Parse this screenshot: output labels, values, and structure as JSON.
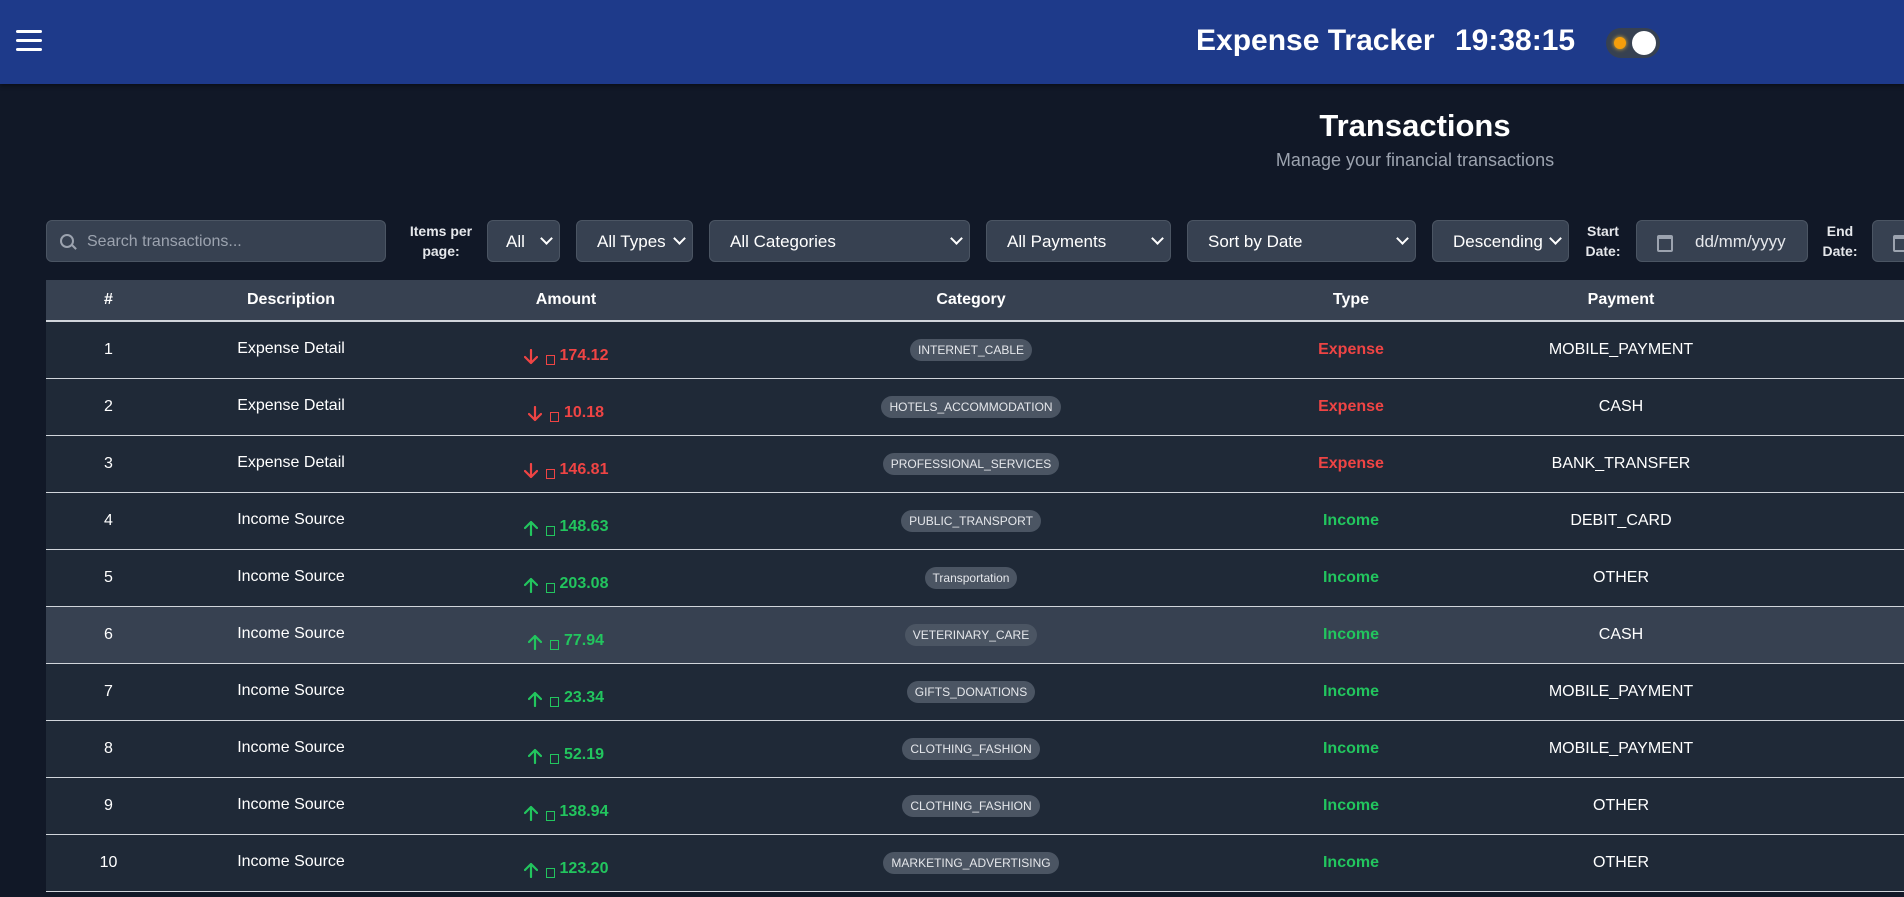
{
  "header": {
    "title": "Expense Tracker",
    "clock": "19:38:15"
  },
  "page": {
    "title": "Transactions",
    "subtitle": "Manage your financial transactions"
  },
  "filters": {
    "search_placeholder": "Search transactions...",
    "items_per_page_label": "Items per page:",
    "items_per_page_value": "All",
    "type_value": "All Types",
    "category_value": "All Categories",
    "payment_value": "All Payments",
    "sort_by_value": "Sort by Date",
    "order_value": "Descending",
    "start_date_label": "Start Date:",
    "start_date_placeholder": "dd/mm/yyyy",
    "end_date_label": "End Date:"
  },
  "table": {
    "columns": [
      "#",
      "Description",
      "Amount",
      "Category",
      "Type",
      "Payment"
    ],
    "rows": [
      {
        "num": "1",
        "description": "Expense Detail",
        "amount": "174.12",
        "category": "INTERNET_CABLE",
        "type": "Expense",
        "payment": "MOBILE_PAYMENT"
      },
      {
        "num": "2",
        "description": "Expense Detail",
        "amount": "10.18",
        "category": "HOTELS_ACCOMMODATION",
        "type": "Expense",
        "payment": "CASH"
      },
      {
        "num": "3",
        "description": "Expense Detail",
        "amount": "146.81",
        "category": "PROFESSIONAL_SERVICES",
        "type": "Expense",
        "payment": "BANK_TRANSFER"
      },
      {
        "num": "4",
        "description": "Income Source",
        "amount": "148.63",
        "category": "PUBLIC_TRANSPORT",
        "type": "Income",
        "payment": "DEBIT_CARD"
      },
      {
        "num": "5",
        "description": "Income Source",
        "amount": "203.08",
        "category": "Transportation",
        "type": "Income",
        "payment": "OTHER"
      },
      {
        "num": "6",
        "description": "Income Source",
        "amount": "77.94",
        "category": "VETERINARY_CARE",
        "type": "Income",
        "payment": "CASH"
      },
      {
        "num": "7",
        "description": "Income Source",
        "amount": "23.34",
        "category": "GIFTS_DONATIONS",
        "type": "Income",
        "payment": "MOBILE_PAYMENT"
      },
      {
        "num": "8",
        "description": "Income Source",
        "amount": "52.19",
        "category": "CLOTHING_FASHION",
        "type": "Income",
        "payment": "MOBILE_PAYMENT"
      },
      {
        "num": "9",
        "description": "Income Source",
        "amount": "138.94",
        "category": "CLOTHING_FASHION",
        "type": "Income",
        "payment": "OTHER"
      },
      {
        "num": "10",
        "description": "Income Source",
        "amount": "123.20",
        "category": "MARKETING_ADVERTISING",
        "type": "Income",
        "payment": "OTHER"
      }
    ]
  },
  "colors": {
    "header_bg": "#1e3a8a",
    "page_bg": "#111827",
    "expense": "#ef4444",
    "income": "#22c55e"
  }
}
